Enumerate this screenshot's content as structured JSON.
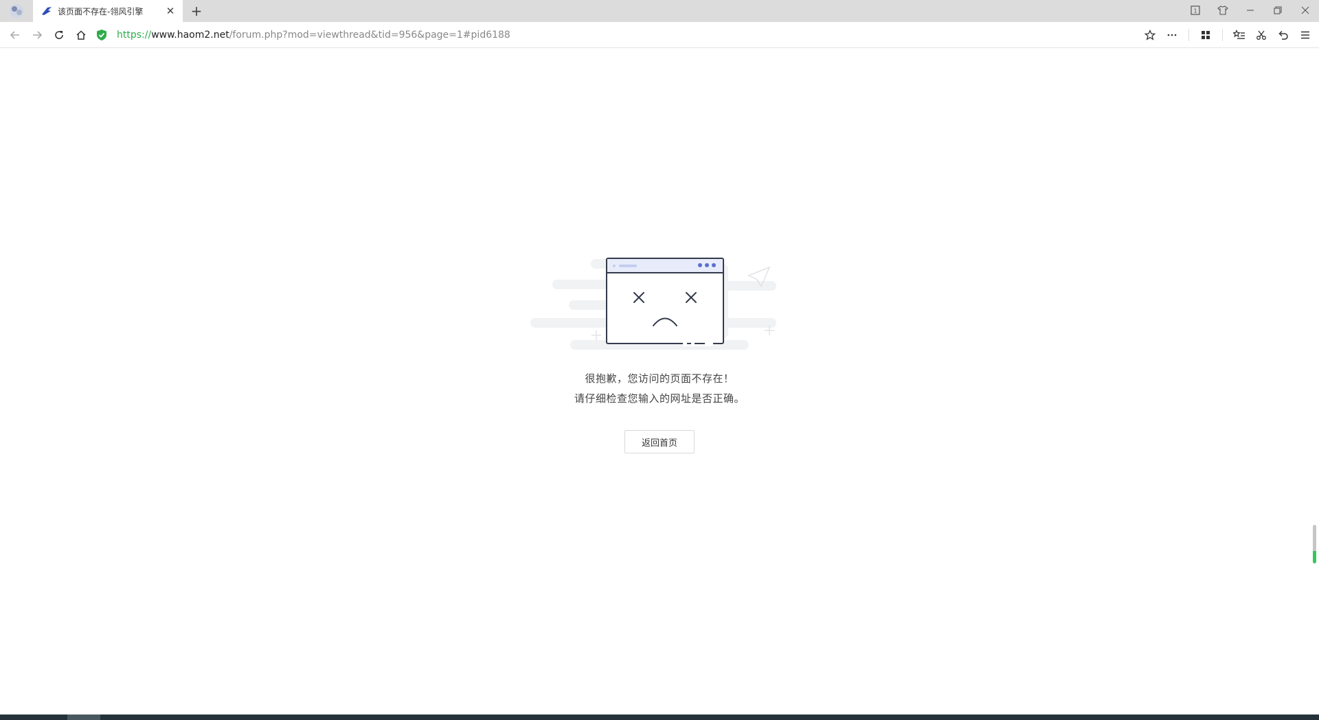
{
  "browser": {
    "tab": {
      "title": "该页面不存在-翎风引擎"
    },
    "window_controls": [
      "restore-down",
      "tile",
      "minimize",
      "maximize",
      "close"
    ]
  },
  "address_bar": {
    "scheme": "https://",
    "host": "www.haom2.net",
    "path": "/forum.php?mod=viewthread&tid=956&page=1#pid6188"
  },
  "page": {
    "message_line1": "很抱歉，您访问的页面不存在！",
    "message_line2": "请仔细检查您输入的网址是否正确。",
    "home_button_label": "返回首页"
  },
  "colors": {
    "accent_blue": "#5b6fd1",
    "secure_green": "#2eac4a",
    "text_dark": "#333333"
  },
  "icons": {
    "back": "arrow-left",
    "forward": "arrow-right",
    "reload": "refresh",
    "home": "house",
    "secure": "shield-check",
    "bookmark": "star",
    "more": "ellipsis",
    "apps": "grid",
    "favorites": "star-list",
    "cut": "scissors",
    "undo": "undo",
    "menu": "hamburger"
  }
}
